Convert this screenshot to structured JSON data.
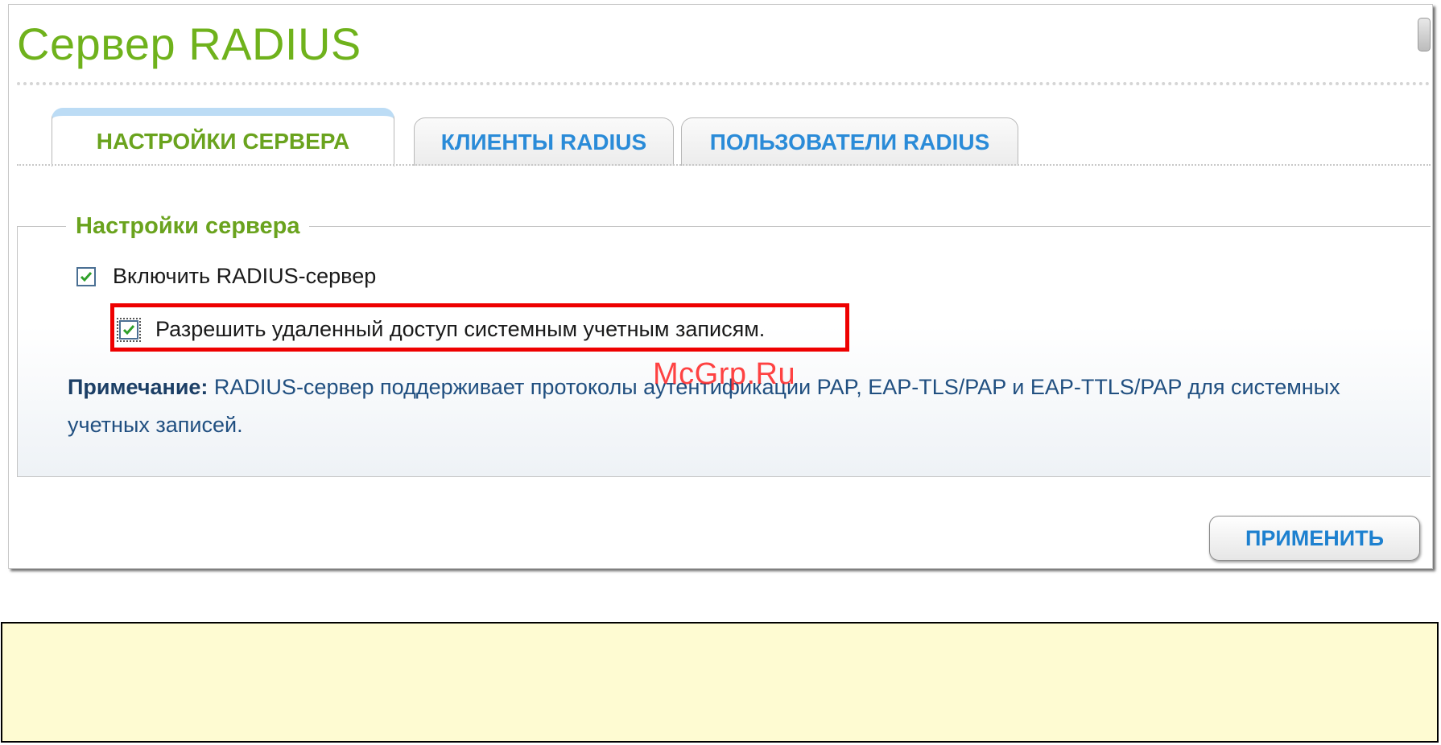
{
  "page": {
    "title": "Сервер RADIUS"
  },
  "tabs": [
    {
      "label": "НАСТРОЙКИ СЕРВЕРА",
      "active": true
    },
    {
      "label": "КЛИЕНТЫ RADIUS",
      "active": false
    },
    {
      "label": "ПОЛЬЗОВАТЕЛИ RADIUS",
      "active": false
    }
  ],
  "server_settings": {
    "legend": "Настройки сервера",
    "enable_radius": {
      "label": "Включить RADIUS-сервер",
      "checked": true
    },
    "allow_remote": {
      "label": "Разрешить удаленный доступ системным учетным записям.",
      "checked": true
    }
  },
  "note": {
    "label": "Примечание:",
    "text": " RADIUS-сервер поддерживает протоколы аутентификации PAP, EAP-TLS/PAP и EAP-TTLS/PAP для системных учетных записей."
  },
  "watermark": "McGrp.Ru",
  "actions": {
    "apply_label": "ПРИМЕНИТЬ"
  },
  "colors": {
    "title_green": "#6fb21c",
    "tab_blue": "#2a8bd8",
    "highlight_red": "#ee0000",
    "note_blue": "#204f80"
  }
}
